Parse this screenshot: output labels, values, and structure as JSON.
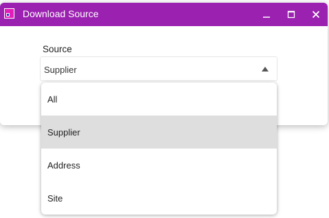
{
  "window": {
    "title": "Download Source",
    "controls": [
      "minimize-icon",
      "maximize-icon",
      "close-icon"
    ]
  },
  "colors": {
    "titlebar": "#9b21b0",
    "selected_option": "#dedede"
  },
  "form": {
    "source_label": "Source",
    "source_value": "Supplier"
  },
  "dropdown": {
    "options": [
      {
        "label": "All"
      },
      {
        "label": "Supplier",
        "selected": true
      },
      {
        "label": "Address"
      },
      {
        "label": "Site"
      }
    ]
  }
}
